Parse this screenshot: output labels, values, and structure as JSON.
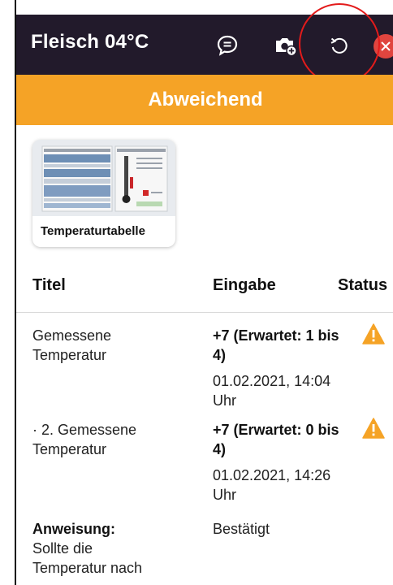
{
  "appbar": {
    "title": "Fleisch 04°C",
    "icons": [
      "chat-icon",
      "camera-icon",
      "refresh-icon",
      "close-icon"
    ]
  },
  "banner": {
    "label": "Abweichend",
    "color": "#f5a326"
  },
  "attachment": {
    "label": "Temperaturtabelle"
  },
  "table": {
    "headers": {
      "title": "Titel",
      "input": "Eingabe",
      "status": "Status"
    },
    "rows": [
      {
        "title_line1": "Gemessene",
        "title_line2": "Temperatur",
        "value_line1": "+7 (Erwartet: 1 bis",
        "value_line2": "4)",
        "timestamp_line1": "01.02.2021, 14:04",
        "timestamp_line2": "Uhr",
        "status_icon": "warning-icon"
      },
      {
        "title_line1": "· 2. Gemessene",
        "title_line2": "Temperatur",
        "value_line1": "+7 (Erwartet: 0 bis",
        "value_line2": "4)",
        "timestamp_line1": "01.02.2021, 14:26",
        "timestamp_line2": "Uhr",
        "status_icon": "warning-icon"
      }
    ],
    "instruction": {
      "label": "Anweisung:",
      "text_line1": "Sollte die",
      "text_line2": "Temperatur nach",
      "value": "Bestätigt"
    }
  },
  "colors": {
    "appbar": "#221a2b",
    "warning": "#f5a326",
    "highlight": "#e31b1b"
  }
}
